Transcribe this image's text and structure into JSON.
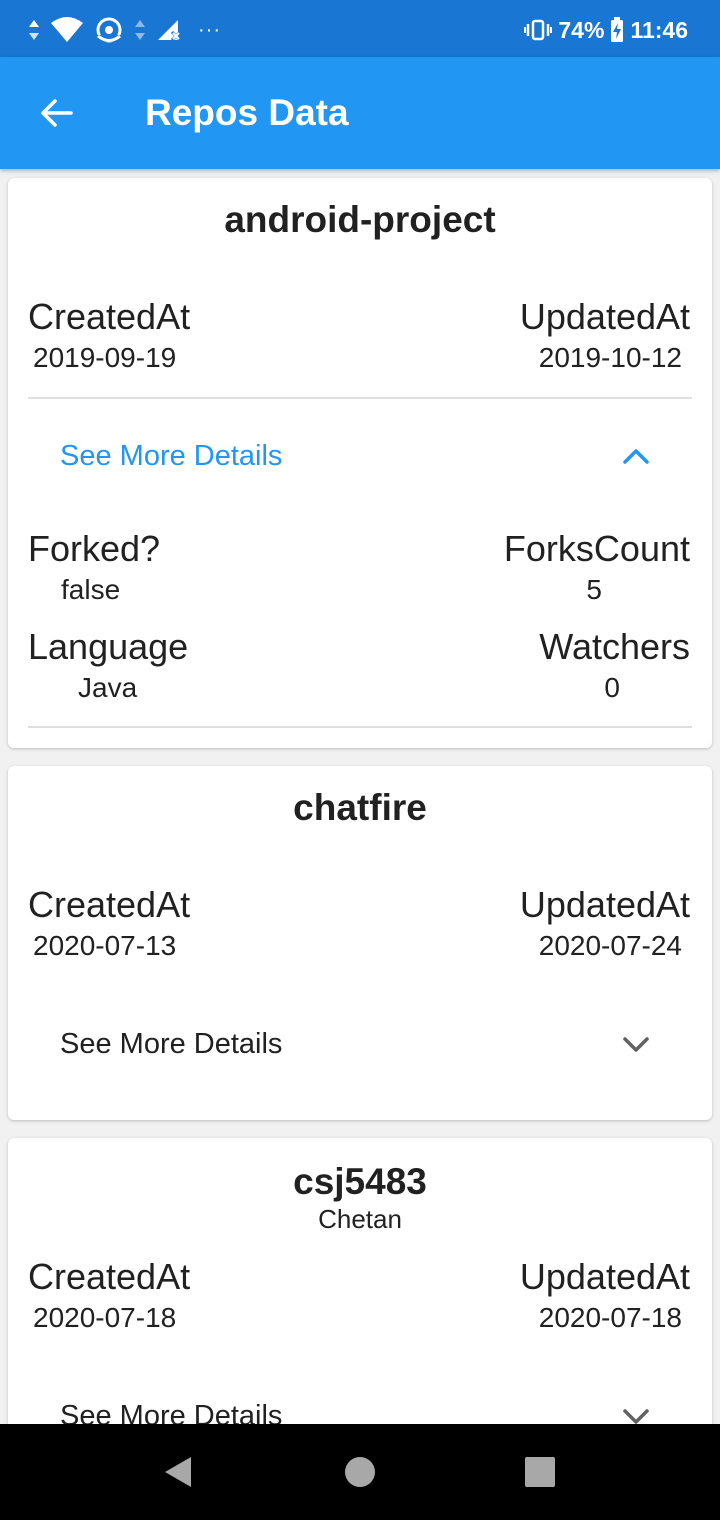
{
  "status_bar": {
    "battery": "74%",
    "time": "11:46",
    "overflow": "···"
  },
  "app_bar": {
    "title": "Repos Data",
    "back_icon": "arrow-back-icon"
  },
  "labels": {
    "created_at": "CreatedAt",
    "updated_at": "UpdatedAt",
    "see_more": "See More Details",
    "forked": "Forked?",
    "forks_count": "ForksCount",
    "language": "Language",
    "watchers": "Watchers"
  },
  "repos": [
    {
      "name": "android-project",
      "owner": "",
      "created_at": "2019-09-19",
      "updated_at": "2019-10-12",
      "expanded": true,
      "details": {
        "forked": "false",
        "forks_count": "5",
        "language": "Java",
        "watchers": "0"
      }
    },
    {
      "name": "chatfire",
      "owner": "",
      "created_at": "2020-07-13",
      "updated_at": "2020-07-24",
      "expanded": false
    },
    {
      "name": "csj5483",
      "owner": "Chetan",
      "created_at": "2020-07-18",
      "updated_at": "2020-07-18",
      "expanded": false
    }
  ],
  "colors": {
    "primary": "#2196f3",
    "primary_dark": "#1976d2",
    "text": "#212121",
    "divider": "#dedede"
  }
}
